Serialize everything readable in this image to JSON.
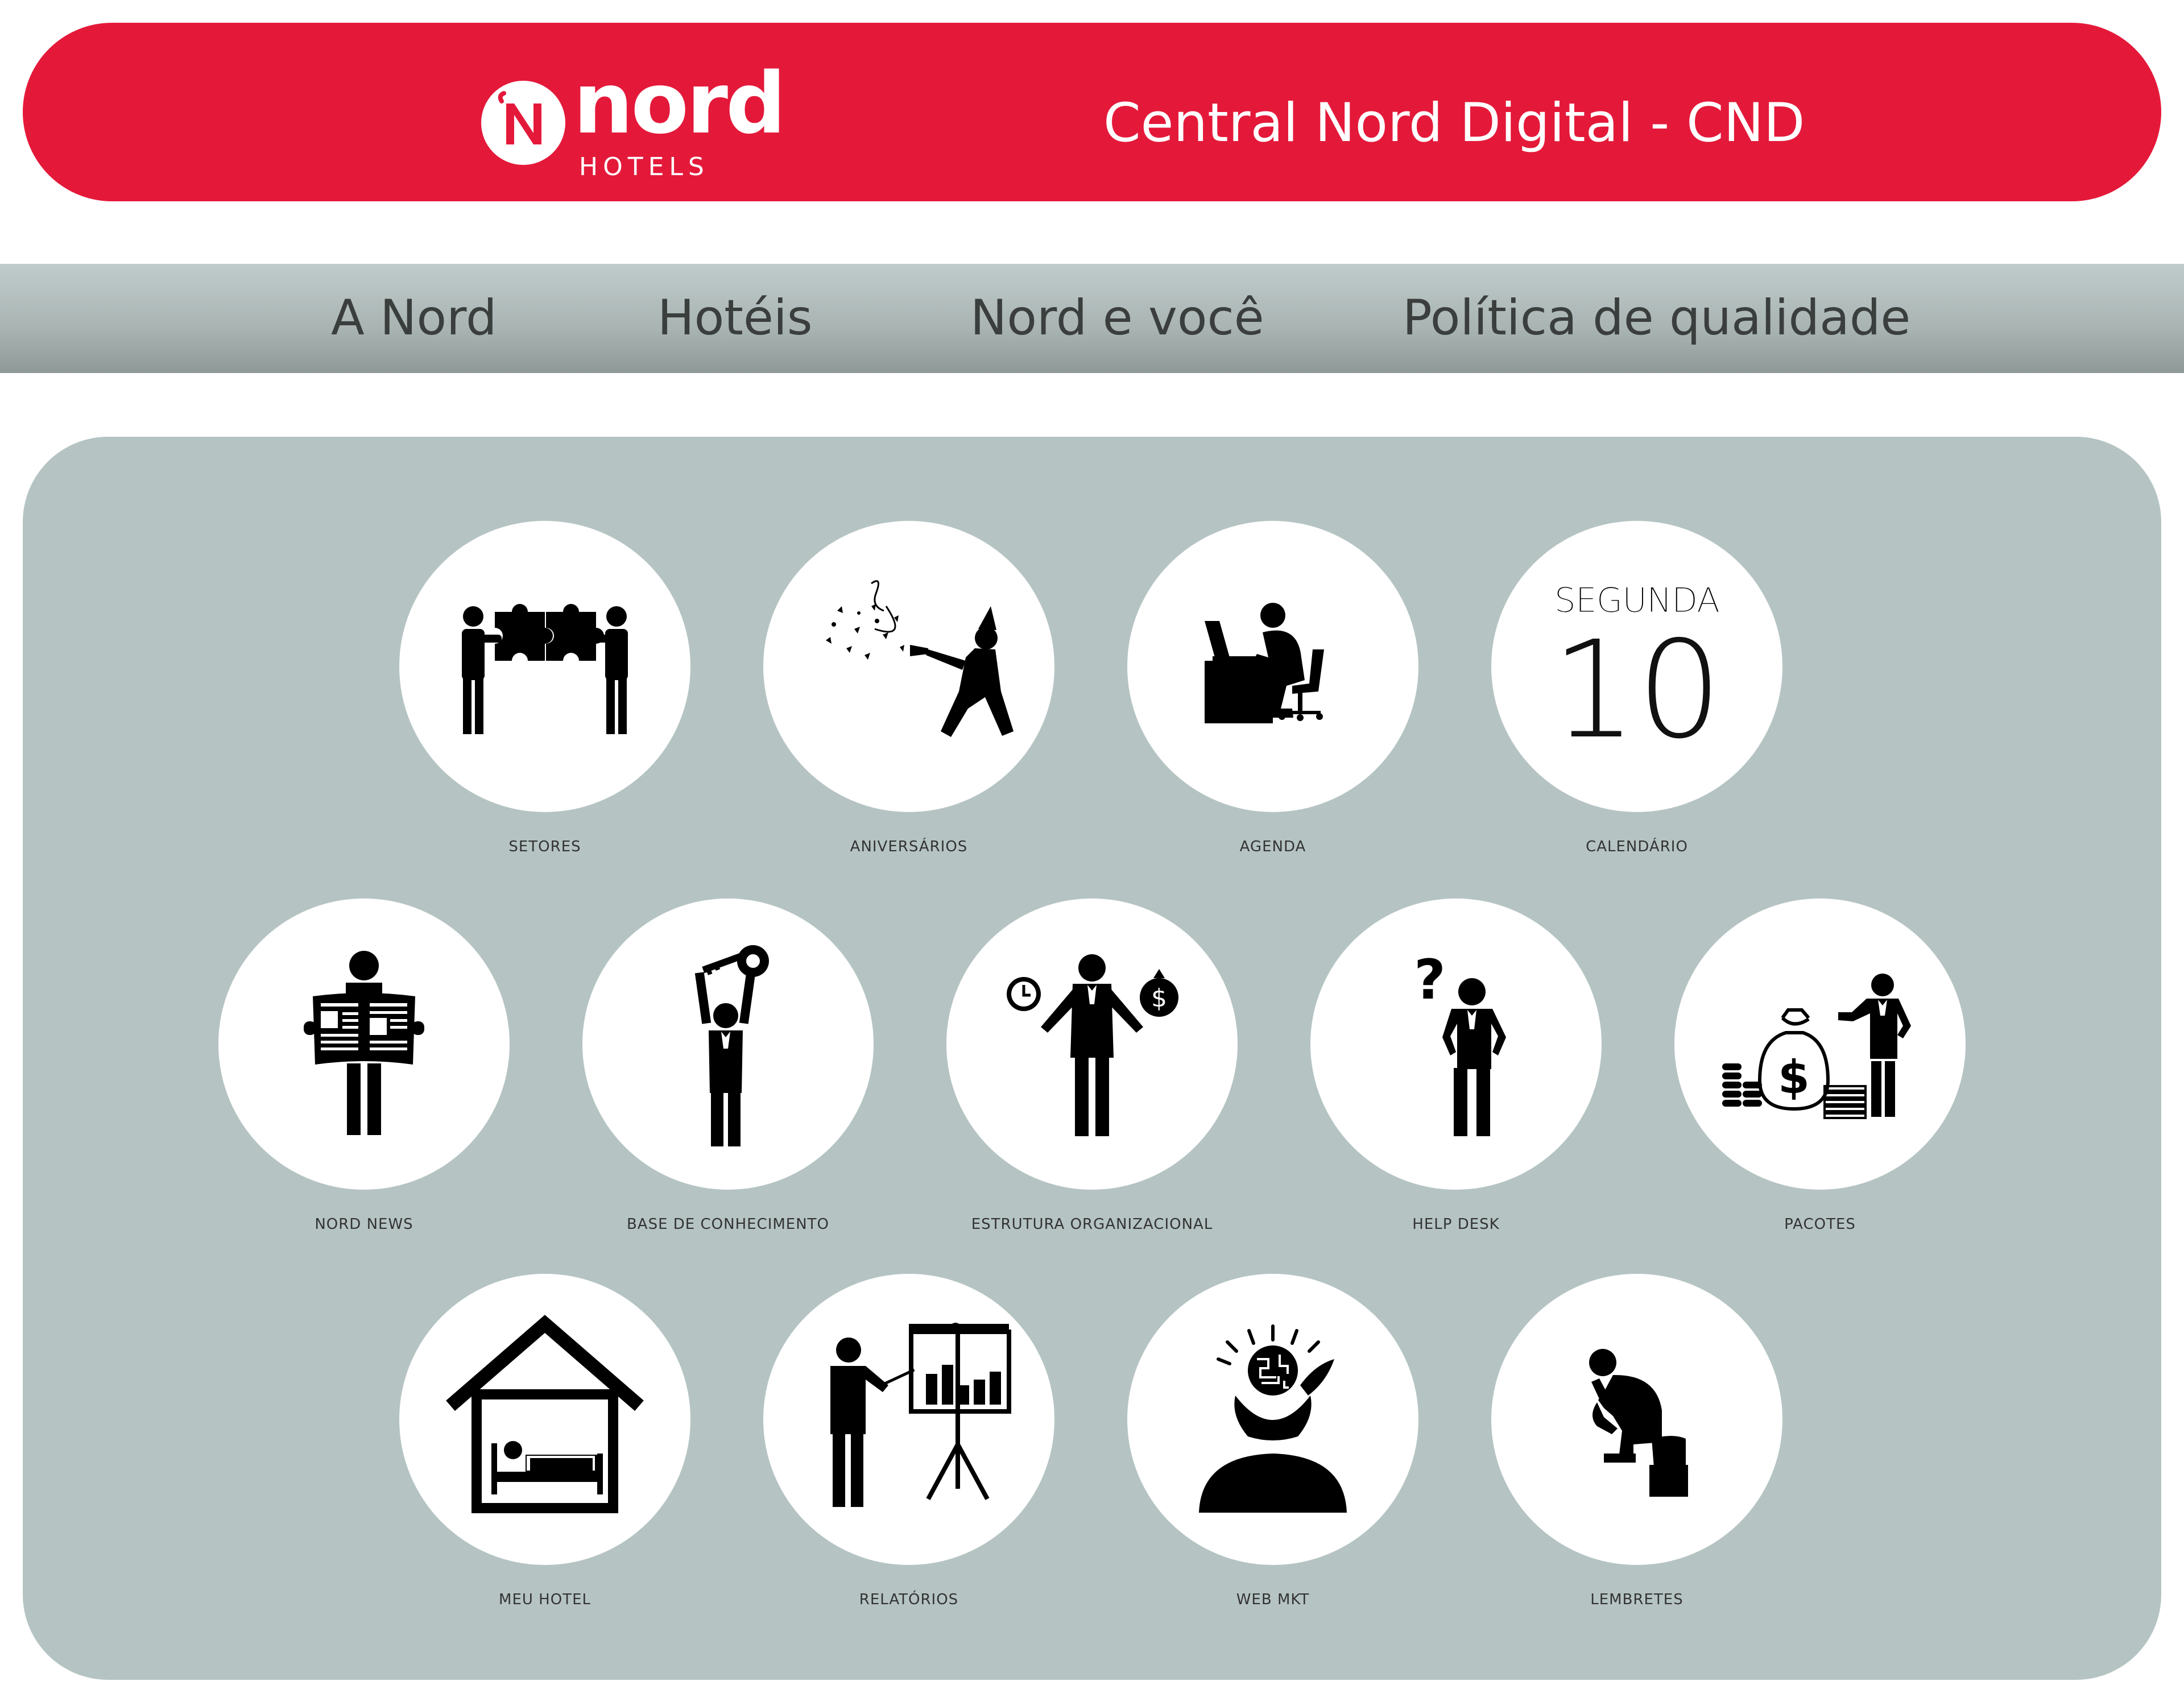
{
  "header": {
    "logo_word": "nord",
    "logo_sub": "HOTELS",
    "title": "Central Nord Digital - CND"
  },
  "nav": {
    "items": [
      {
        "label": "A Nord"
      },
      {
        "label": "Hotéis"
      },
      {
        "label": "Nord e você"
      },
      {
        "label": "Política de qualidade"
      }
    ]
  },
  "tiles": [
    {
      "label": "SETORES",
      "icon": "puzzle-people-icon"
    },
    {
      "label": "ANIVERSÁRIOS",
      "icon": "party-confetti-icon"
    },
    {
      "label": "AGENDA",
      "icon": "person-at-desk-icon"
    },
    {
      "label": "CALENDÁRIO",
      "icon": "calendar-icon",
      "day": "SEGUNDA",
      "date": "10"
    },
    {
      "label": "NORD NEWS",
      "icon": "newspaper-reader-icon"
    },
    {
      "label": "BASE DE CONHECIMENTO",
      "icon": "person-holding-key-icon"
    },
    {
      "label": "ESTRUTURA ORGANIZACIONAL",
      "icon": "time-money-balance-icon"
    },
    {
      "label": "HELP DESK",
      "icon": "question-person-icon"
    },
    {
      "label": "PACOTES",
      "icon": "money-bag-person-icon"
    },
    {
      "label": "MEU HOTEL",
      "icon": "house-bed-icon"
    },
    {
      "label": "RELATÓRIOS",
      "icon": "presentation-chart-icon"
    },
    {
      "label": "WEB MKT",
      "icon": "brain-head-icon"
    },
    {
      "label": "LEMBRETES",
      "icon": "thinker-icon"
    }
  ],
  "colors": {
    "brand_red": "#e4193a",
    "panel": "#b5c4c3",
    "nav_gradient_top": "#c0cccb",
    "nav_gradient_bottom": "#8f9998"
  }
}
